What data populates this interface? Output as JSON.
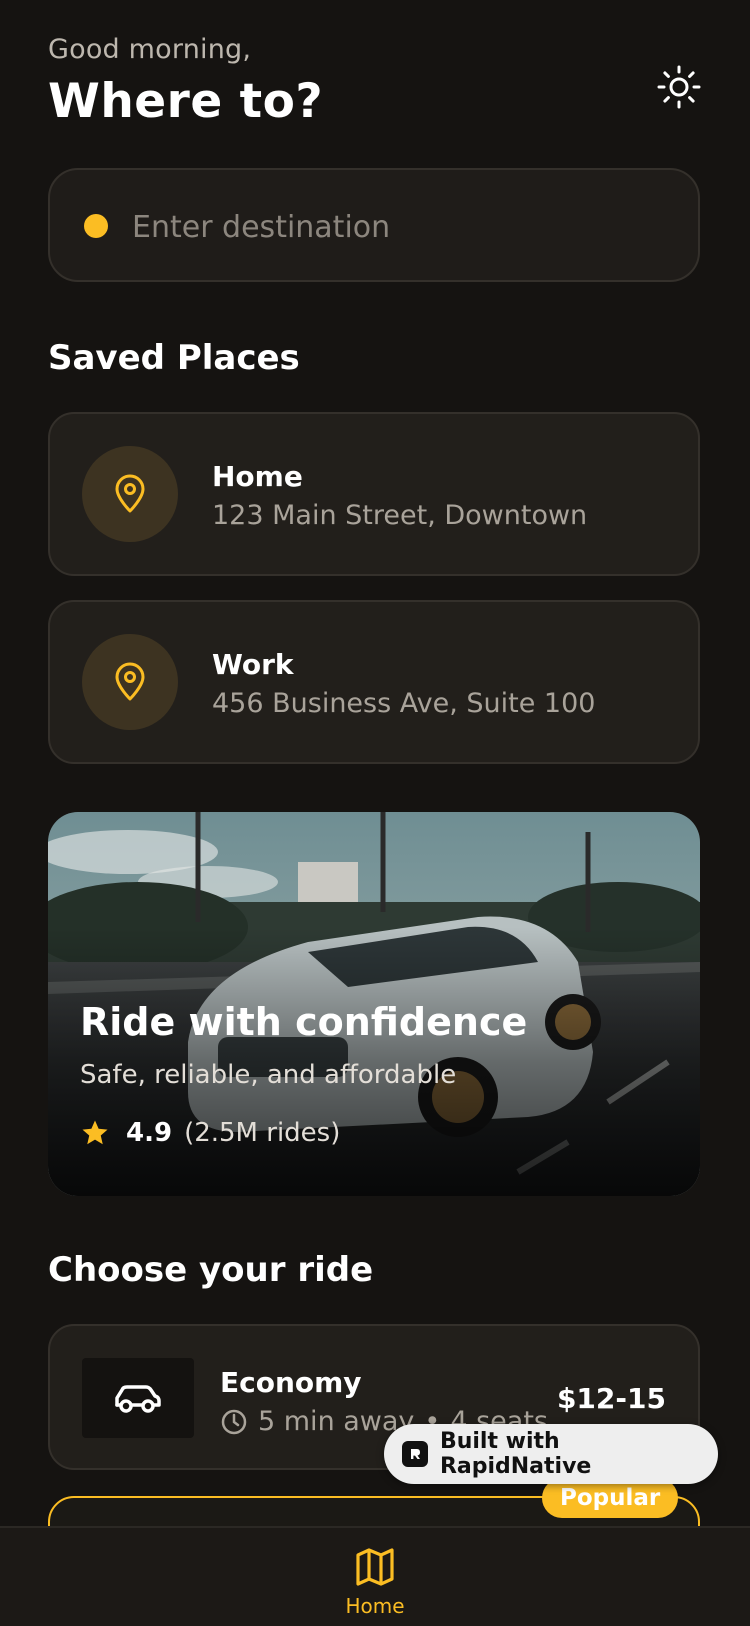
{
  "header": {
    "greeting": "Good morning,",
    "title": "Where to?",
    "theme_icon": "sun-icon"
  },
  "search": {
    "placeholder": "Enter destination"
  },
  "saved_places": {
    "title": "Saved Places",
    "items": [
      {
        "name": "Home",
        "address": "123 Main Street, Downtown",
        "icon": "map-pin-icon"
      },
      {
        "name": "Work",
        "address": "456 Business Ave, Suite 100",
        "icon": "map-pin-icon"
      }
    ]
  },
  "hero": {
    "title": "Ride with confidence",
    "subtitle": "Safe, reliable, and affordable",
    "rating": "4.9",
    "rides": "(2.5M rides)"
  },
  "rides": {
    "title": "Choose your ride",
    "items": [
      {
        "name": "Economy",
        "eta": "5 min away",
        "separator": "•",
        "seats": "4 seats",
        "price": "$12-15",
        "icon": "car-icon"
      }
    ],
    "popular_badge": "Popular"
  },
  "badge": {
    "label": "Built with RapidNative"
  },
  "tabbar": {
    "home_label": "Home",
    "home_icon": "map-icon"
  },
  "colors": {
    "accent": "#fbbd23",
    "background": "#151311",
    "card": "#221f1b"
  }
}
